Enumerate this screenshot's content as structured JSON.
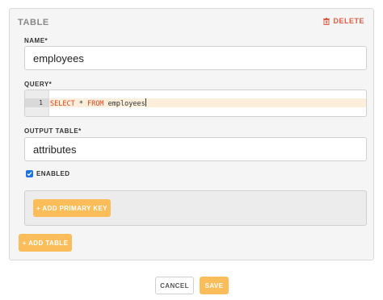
{
  "panel": {
    "title": "TABLE",
    "delete_label": "DELETE"
  },
  "name_field": {
    "label": "NAME*",
    "value": "employees"
  },
  "query_field": {
    "label": "QUERY*",
    "line_number": "1",
    "keyword_select": "SELECT",
    "star": " * ",
    "keyword_from": "FROM",
    "table": " employees"
  },
  "output_table_field": {
    "label": "OUTPUT TABLE*",
    "value": "attributes"
  },
  "enabled_checkbox": {
    "label": "ENABLED",
    "checked": true
  },
  "primary_key": {
    "add_label": "+ ADD PRIMARY KEY"
  },
  "add_table_label": "+ ADD TABLE",
  "footer": {
    "cancel_label": "CANCEL",
    "save_label": "SAVE"
  },
  "colors": {
    "accent_yellow": "#fbbd5a",
    "delete_red": "#e05a44",
    "keyword_red": "#d6461f",
    "checkbox_blue": "#1a73e8",
    "active_line": "#fbeedb"
  }
}
